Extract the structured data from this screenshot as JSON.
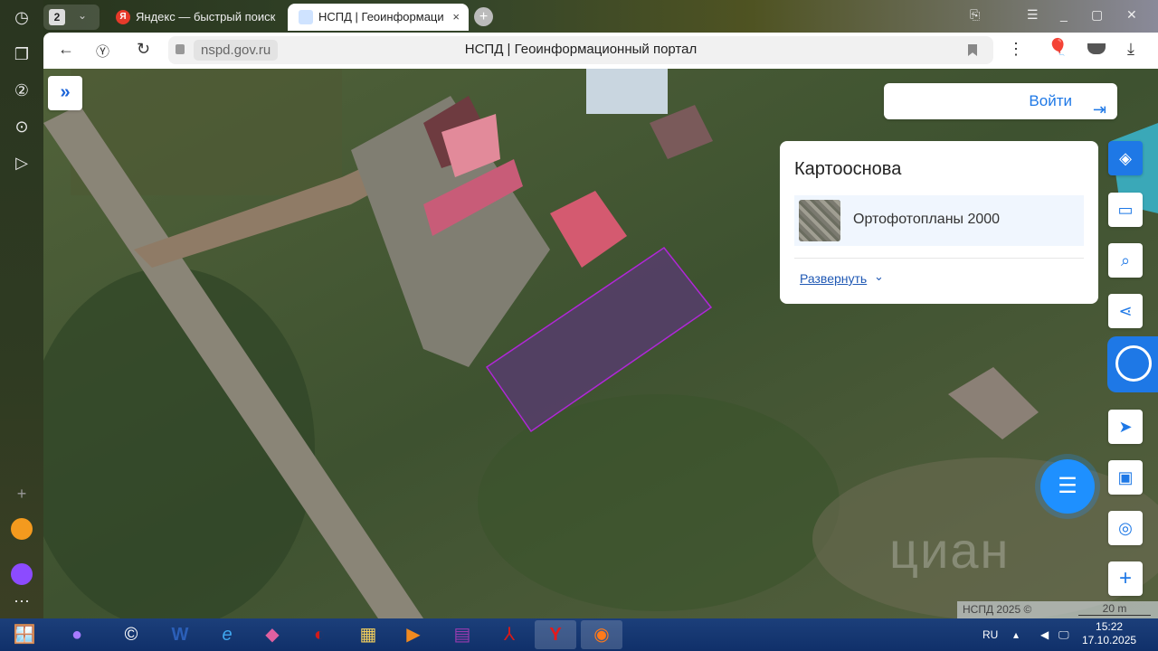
{
  "browser": {
    "tab_count": "2",
    "tabs": [
      {
        "label": "Яндекс — быстрый поиск"
      },
      {
        "label": "НСПД | Геоинформаци"
      }
    ],
    "url": "nspd.gov.ru",
    "page_title": "НСПД | Геоинформационный портал"
  },
  "map": {
    "login_label": "Войти",
    "basemap_card": {
      "title": "Картооснова",
      "layer": "Ортофотопланы 2000",
      "expand_label": "Развернуть"
    },
    "attribution": "НСПД 2025 ©",
    "scale": "20 m",
    "watermark": "циан",
    "parcel_color": "#7a2bb0"
  },
  "taskbar": {
    "lang": "RU",
    "time": "15:22",
    "date": "17.10.2025"
  }
}
